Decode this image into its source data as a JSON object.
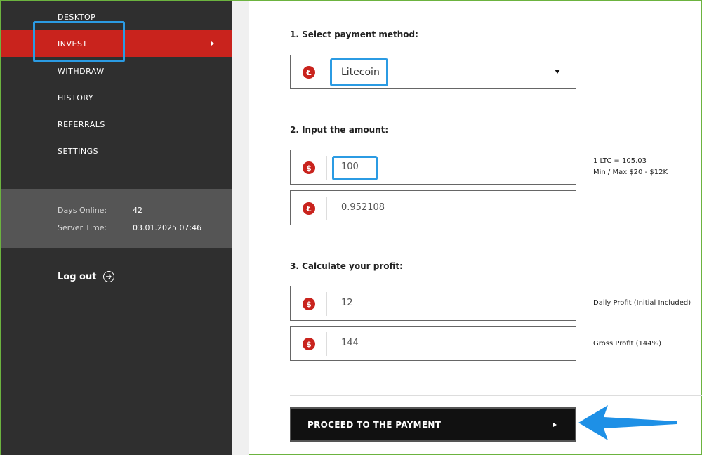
{
  "sidebar": {
    "items": [
      {
        "label": "DESKTOP"
      },
      {
        "label": "INVEST"
      },
      {
        "label": "WITHDRAW"
      },
      {
        "label": "HISTORY"
      },
      {
        "label": "REFERRALS"
      },
      {
        "label": "SETTINGS"
      }
    ],
    "active_item": "INVEST",
    "server_info": {
      "days_online_label": "Days Online:",
      "days_online_value": "42",
      "server_time_label": "Server Time:",
      "server_time_value": "03.01.2025 07:46"
    },
    "logout_label": "Log out",
    "logout_icon": "arrow-right-circle-icon"
  },
  "main": {
    "step1": {
      "title": "1. Select payment method:",
      "selected_method": "Litecoin",
      "coin_icon": "litecoin-icon",
      "coin_symbol": "Ł"
    },
    "step2": {
      "title": "2. Input the amount:",
      "usd_amount": "100",
      "ltc_amount": "0.952108",
      "usd_icon": "dollar-icon",
      "usd_symbol": "$",
      "ltc_icon": "litecoin-icon",
      "ltc_symbol": "Ł",
      "rate_note": "1 LTC = 105.03",
      "limits_note": "Min / Max $20 - $12K"
    },
    "step3": {
      "title": "3. Calculate your profit:",
      "daily_profit": "12",
      "daily_profit_label": "Daily Profit (Initial Included)",
      "gross_profit": "144",
      "gross_profit_label": "Gross Profit (144%)",
      "usd_symbol": "$"
    },
    "proceed_button_label": "PROCEED TO THE PAYMENT"
  },
  "colors": {
    "sidebar_bg": "#2f2f2f",
    "active_item_bg": "#c9231d",
    "server_box_bg": "#555555",
    "coin_red": "#c9231d",
    "highlight_blue": "#2b9be3",
    "button_bg": "#111111",
    "frame_green": "#6cb33f"
  }
}
